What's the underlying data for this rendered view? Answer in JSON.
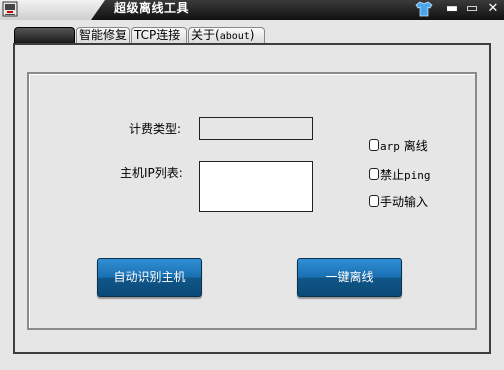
{
  "window": {
    "title": "超级离线工具",
    "minimize_glyph": "▬",
    "maximize_glyph": "▭",
    "close_glyph": "✕"
  },
  "tabs": [
    {
      "label": ""
    },
    {
      "label": "智能修复"
    },
    {
      "label": "TCP连接"
    },
    {
      "label_prefix": "关于(",
      "label_word": "about",
      "label_suffix": ")"
    }
  ],
  "form": {
    "billing_type_label": "计费类型:",
    "billing_type_value": "",
    "host_ip_list_label": "主机IP列表:",
    "host_ip_list_value": ""
  },
  "options": [
    {
      "prefix": "arp",
      "label": " 离线",
      "checked": false
    },
    {
      "prefix": "禁止",
      "label": "ping",
      "checked": false
    },
    {
      "prefix": "",
      "label": "手动输入",
      "checked": false
    }
  ],
  "buttons": {
    "auto_detect": "自动识别主机",
    "one_click_offline": "一键离线"
  },
  "icons": {
    "app": "app-icon",
    "skin": "tshirt-icon"
  },
  "colors": {
    "titlebar": "#1e1e1e",
    "button_blue": "#1a6fb0",
    "panel": "#e6e6e6"
  }
}
